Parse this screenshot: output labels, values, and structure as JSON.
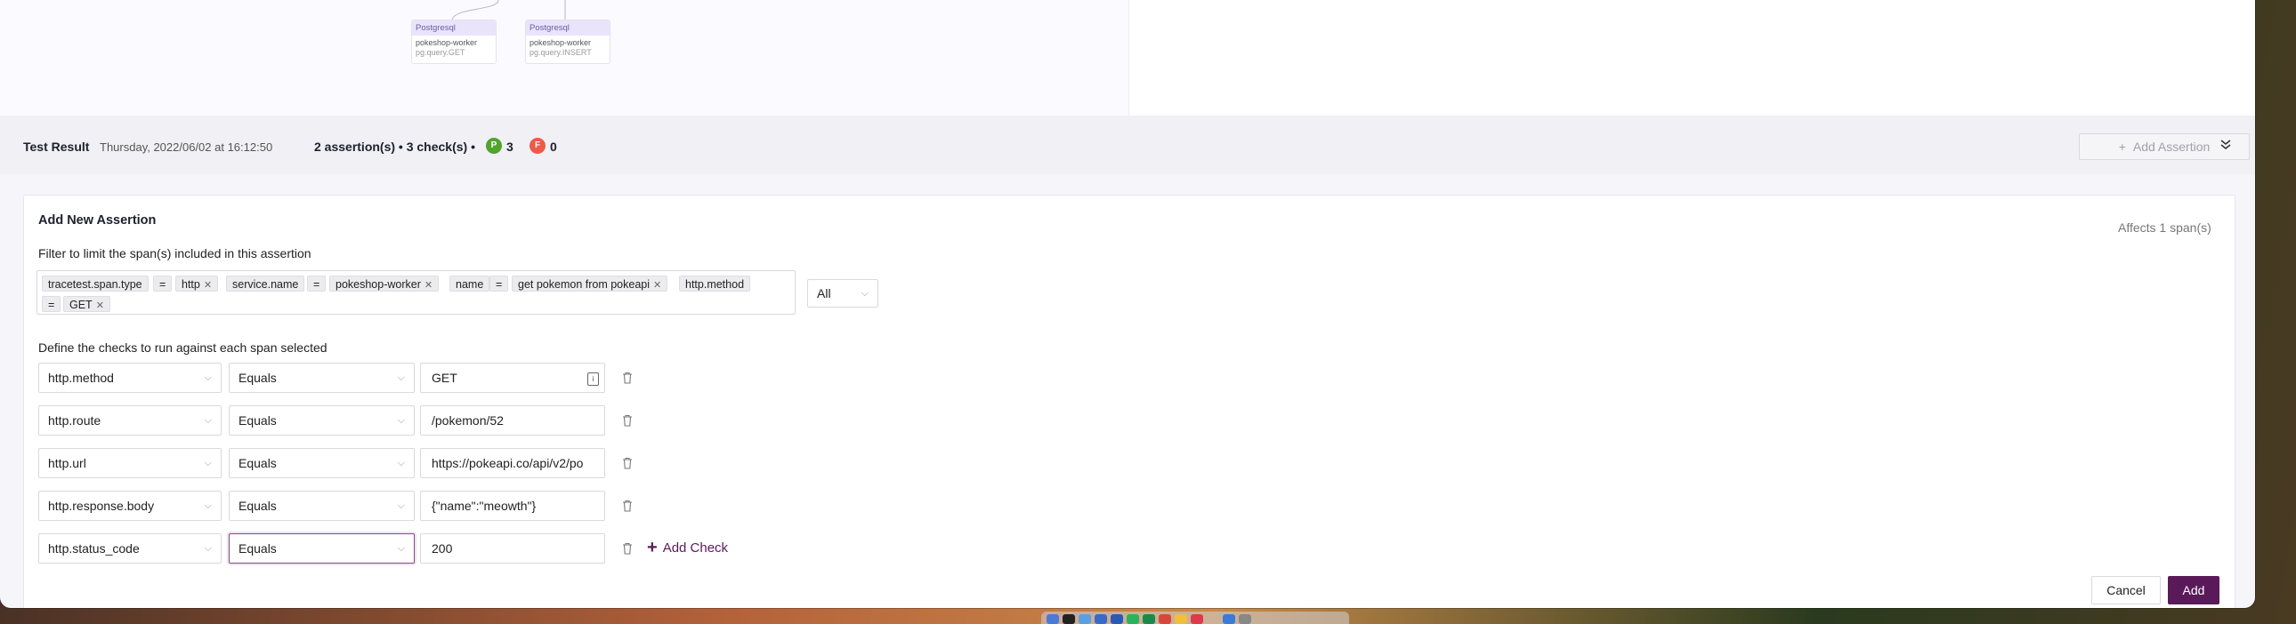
{
  "diagram": {
    "nodes": [
      {
        "type": "Postgresql",
        "service": "pokeshop-worker",
        "op": "pg.query.GET"
      },
      {
        "type": "Postgresql",
        "service": "pokeshop-worker",
        "op": "pg.query.INSERT"
      }
    ]
  },
  "result": {
    "title": "Test Result",
    "date": "Thursday, 2022/06/02 at 16:12:50",
    "summary": "2 assertion(s) • 3 check(s) •",
    "pass_badge": "P",
    "pass_count": "3",
    "fail_badge": "F",
    "fail_count": "0",
    "add_assertion": "Add Assertion"
  },
  "form": {
    "title": "Add New Assertion",
    "affects": "Affects 1 span(s)",
    "filter_label": "Filter to limit the span(s) included in this assertion",
    "filter_tags": [
      "tracetest.span.type",
      "=",
      "http",
      "service.name",
      "=",
      "pokeshop-worker",
      "name",
      "=",
      "get pokemon from pokeapi",
      "http.method",
      "=",
      "GET"
    ],
    "selector_mode": "All",
    "checks_label": "Define the checks to run against each span selected",
    "checks": [
      {
        "attribute": "http.method",
        "comparator": "Equals",
        "value": "GET"
      },
      {
        "attribute": "http.route",
        "comparator": "Equals",
        "value": "/pokemon/52"
      },
      {
        "attribute": "http.url",
        "comparator": "Equals",
        "value": "https://pokeapi.co/api/v2/po"
      },
      {
        "attribute": "http.response.body",
        "comparator": "Equals",
        "value": "{\"name\":\"meowth\"}"
      },
      {
        "attribute": "http.status_code",
        "comparator": "Equals",
        "value": "200"
      }
    ],
    "add_check": "Add Check",
    "cancel": "Cancel",
    "add": "Add"
  },
  "colors": {
    "accent": "#5a1a5a",
    "pass": "#52a32e",
    "fail": "#ee5a4a"
  }
}
